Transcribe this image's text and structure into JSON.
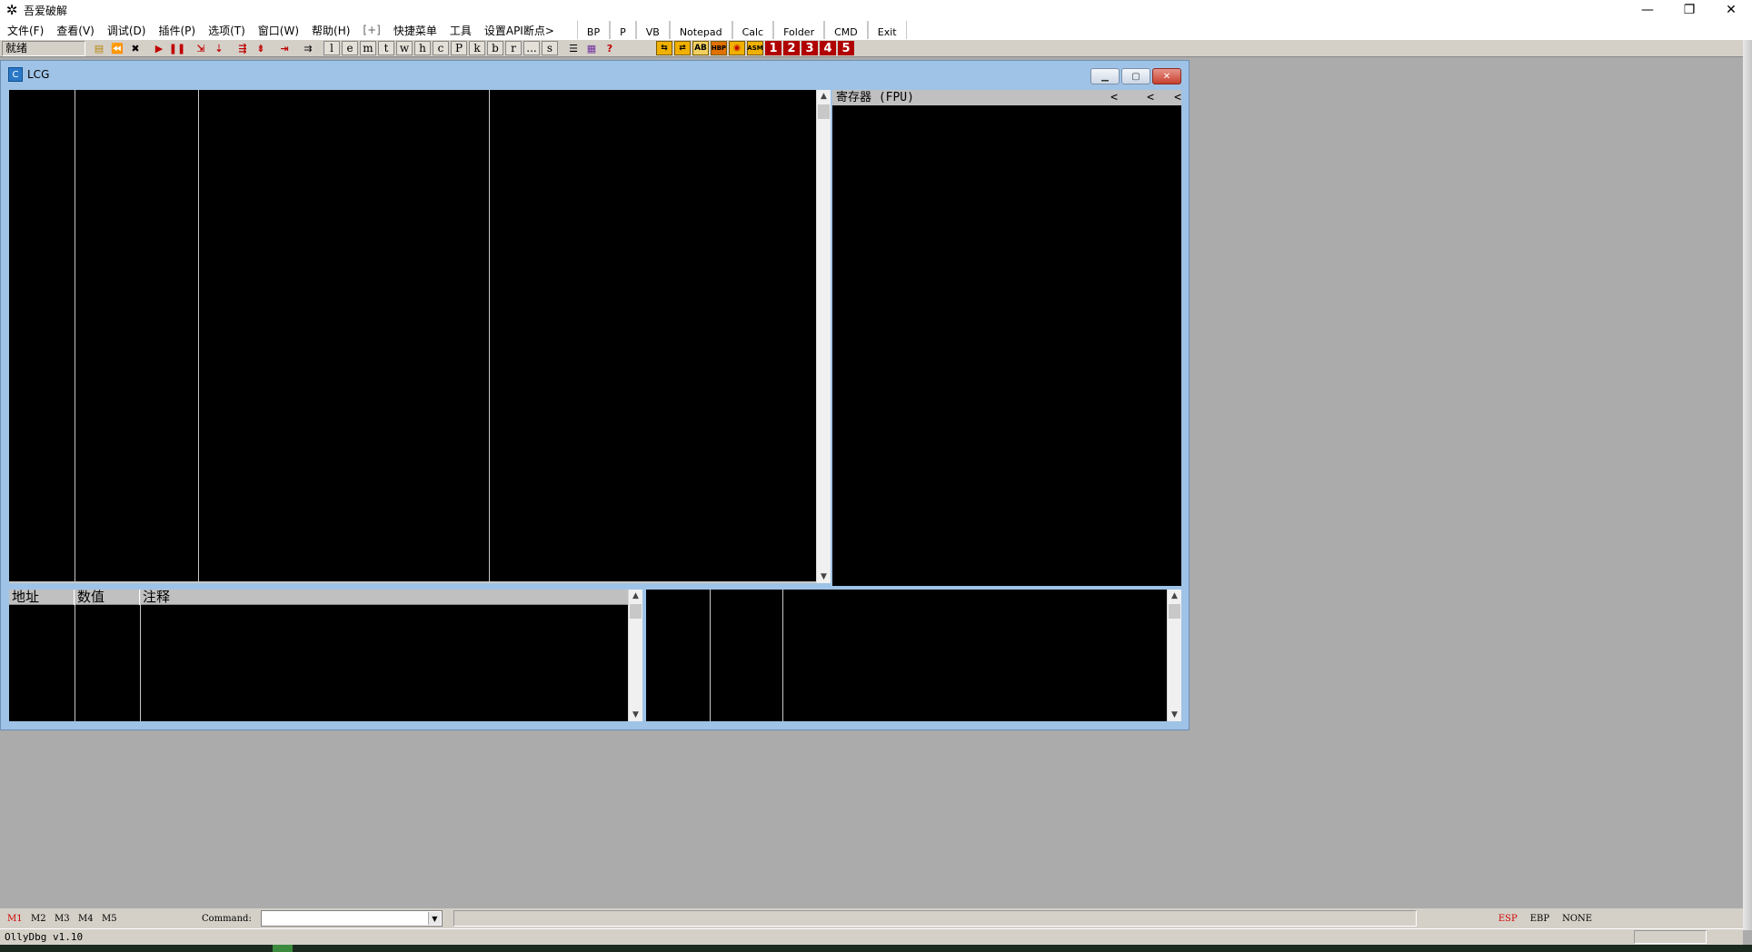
{
  "app": {
    "title": "吾爱破解",
    "icon": "bug-icon"
  },
  "window_controls": {
    "minimize": "—",
    "restore": "❐",
    "close": "✕"
  },
  "menu": [
    "文件(F)",
    "查看(V)",
    "调试(D)",
    "插件(P)",
    "选项(T)",
    "窗口(W)",
    "帮助(H)",
    "[+]",
    "快捷菜单",
    "工具",
    "设置API断点>"
  ],
  "quick_buttons": [
    "BP",
    "P",
    "VB",
    "Notepad",
    "Calc",
    "Folder",
    "CMD",
    "Exit"
  ],
  "toolbar": {
    "status": "就绪",
    "letters": [
      "l",
      "e",
      "m",
      "t",
      "w",
      "h",
      "c",
      "P",
      "k",
      "b",
      "r",
      "...",
      "s"
    ],
    "colored": [
      "⇆",
      "⇄",
      "AB",
      "HBP",
      "◉",
      "ASM"
    ],
    "numbers": [
      "1",
      "2",
      "3",
      "4",
      "5"
    ]
  },
  "cpu_window": {
    "title": "LCG",
    "fpu_header": "寄存器 (FPU)",
    "fpu_arrows": [
      "<",
      "<",
      "<"
    ],
    "dump_headers": [
      "地址",
      "数值",
      "注释"
    ]
  },
  "command_bar": {
    "tabs": [
      "M1",
      "M2",
      "M3",
      "M4",
      "M5"
    ],
    "active_tab": "M1",
    "label": "Command:",
    "input_value": "",
    "registers": [
      "ESP",
      "EBP",
      "NONE"
    ],
    "active_register": "ESP"
  },
  "status": {
    "text": "OllyDbg v1.10"
  },
  "colors": {
    "mdi_background": "#ababab",
    "pane_background": "#000000",
    "child_frame": "#9fc3e6",
    "accent_red": "#d00000"
  }
}
